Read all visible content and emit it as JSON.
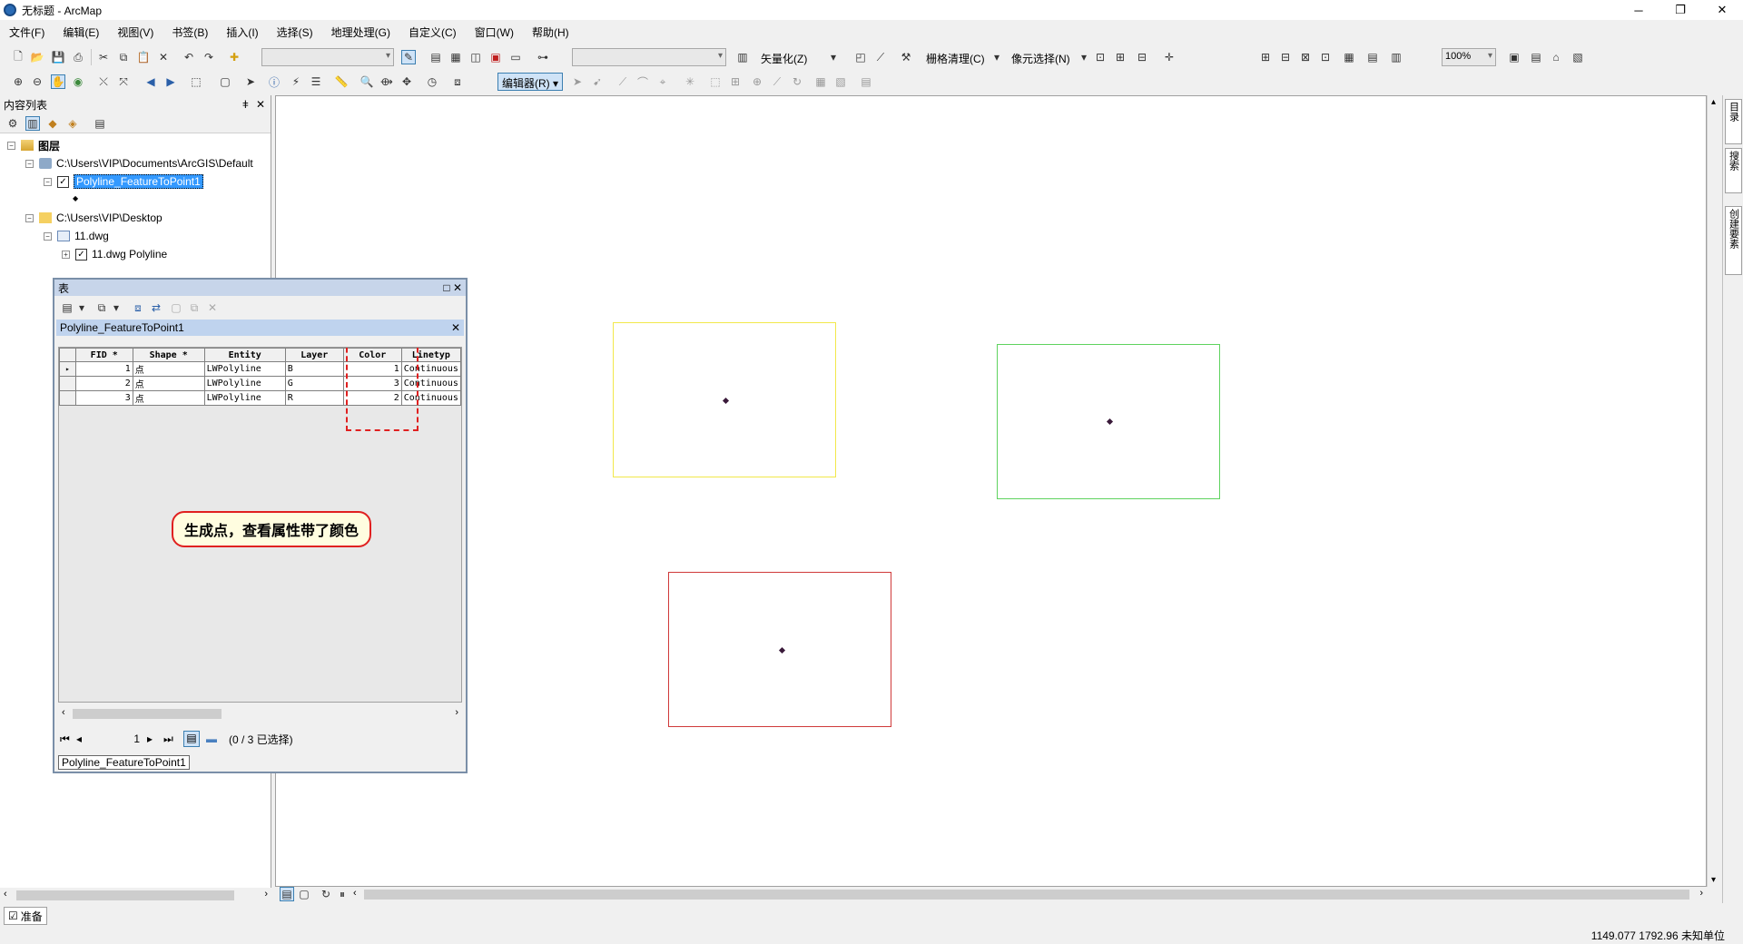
{
  "window": {
    "title": "无标题 - ArcMap",
    "min": "─",
    "restore": "❐",
    "close": "✕"
  },
  "menu": [
    "文件(F)",
    "编辑(E)",
    "视图(V)",
    "书签(B)",
    "插入(I)",
    "选择(S)",
    "地理处理(G)",
    "自定义(C)",
    "窗口(W)",
    "帮助(H)"
  ],
  "toolbar": {
    "vectorize_label": "矢量化(Z)",
    "raster_cleanup_label": "栅格清理(C)",
    "cell_select_label": "像元选择(N)",
    "zoom_value": "100%",
    "editor_label": "编辑器(R)"
  },
  "toc": {
    "title": "内容列表",
    "pin": "ǂ",
    "close": "✕",
    "root": "图层",
    "items": [
      {
        "label": "C:\\Users\\VIP\\Documents\\ArcGIS\\Default"
      },
      {
        "label": "Polyline_FeatureToPoint1",
        "checked": true,
        "selected": true
      },
      {
        "label": "C:\\Users\\VIP\\Desktop"
      },
      {
        "label": "11.dwg"
      },
      {
        "label": "11.dwg Polyline",
        "checked": true
      }
    ]
  },
  "table_window": {
    "title": "表",
    "subtitle": "Polyline_FeatureToPoint1",
    "columns": [
      "FID *",
      "Shape *",
      "Entity",
      "Layer",
      "Color",
      "Linetyp"
    ],
    "rows": [
      [
        "1",
        "点",
        "LWPolyline",
        "B",
        "1",
        "Continuous"
      ],
      [
        "2",
        "点",
        "LWPolyline",
        "G",
        "3",
        "Continuous"
      ],
      [
        "3",
        "点",
        "LWPolyline",
        "R",
        "2",
        "Continuous"
      ]
    ],
    "annotation": "生成点，查看属性带了颜色",
    "record_number": "1",
    "selection_status": "(0 / 3 已选择)",
    "tab_label": "Polyline_FeatureToPoint1"
  },
  "map": {
    "features": [
      {
        "name": "yellow-rectangle",
        "color": "#f2e84b"
      },
      {
        "name": "green-rectangle",
        "color": "#5fd35f"
      },
      {
        "name": "red-rectangle",
        "color": "#d03a3a"
      }
    ]
  },
  "side_tabs": [
    "目录",
    "搜索",
    "创建要素"
  ],
  "status": {
    "ready": "准备",
    "coordinates": "1149.077  1792.96 未知单位"
  }
}
